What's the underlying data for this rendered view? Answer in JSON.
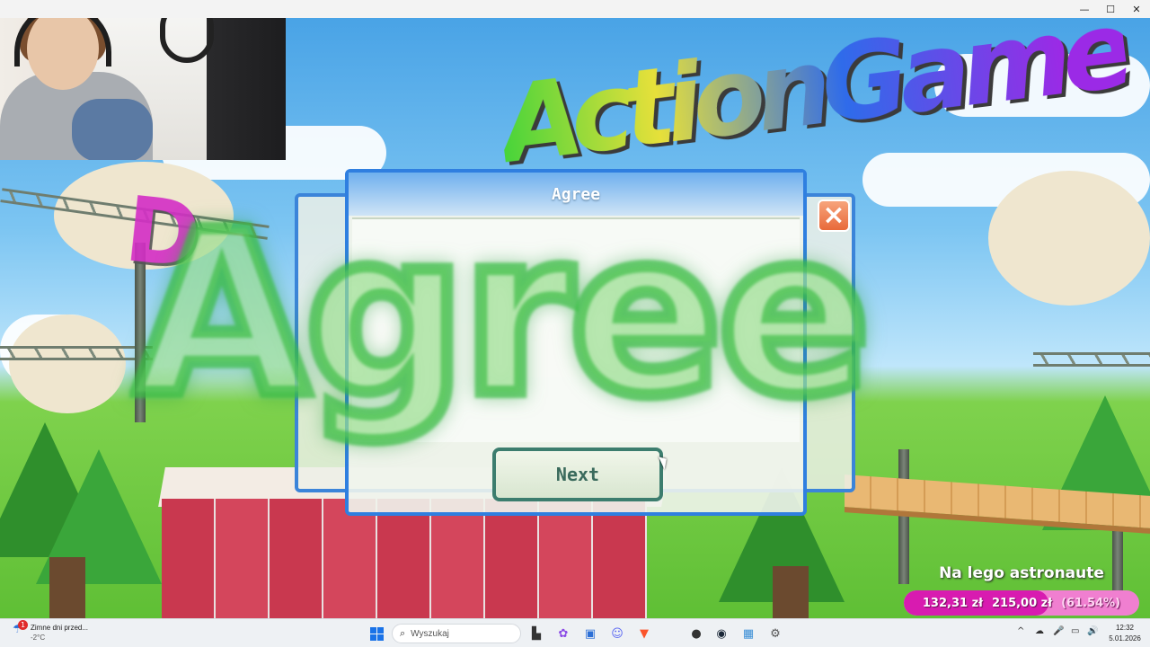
{
  "window": {
    "minimize_icon": "minimize-icon",
    "maximize_icon": "maximize-icon",
    "close_icon": "close-icon",
    "minimize_glyph": "—",
    "maximize_glyph": "☐",
    "close_glyph": "✕"
  },
  "game": {
    "title_partial": "ActionGame",
    "title_left_partial": "D"
  },
  "dialog": {
    "title": "Agree",
    "next_label": "Next",
    "close_glyph": "×",
    "overlay_text": "Agree"
  },
  "donation": {
    "label": "Na lego astronaute",
    "current": "132,31 zł",
    "goal": "215,00 zł",
    "percent": "(61.54%)",
    "fill_fraction": 0.6154,
    "bar_color": "#d81bb0"
  },
  "taskbar": {
    "weather": {
      "text": "Zimne dni przed...",
      "temp": "-2°C",
      "badge": "1"
    },
    "search_placeholder": "Wyszukaj",
    "apps": [
      {
        "name": "file-explorer-icon",
        "glyph": "▙"
      },
      {
        "name": "copilot-icon",
        "glyph": "✿"
      },
      {
        "name": "store-icon",
        "glyph": "▣"
      },
      {
        "name": "discord-icon",
        "glyph": "☺"
      },
      {
        "name": "brave-icon",
        "glyph": "▼"
      },
      {
        "name": "obs-icon",
        "glyph": "●"
      },
      {
        "name": "steam-icon",
        "glyph": "◉"
      },
      {
        "name": "game-app-icon",
        "glyph": "▦"
      },
      {
        "name": "settings-icon",
        "glyph": "⚙"
      }
    ],
    "tray": [
      "^",
      "☁",
      "🎤",
      "▭",
      "🔊"
    ],
    "time": "12:32",
    "date": "5.01.2026"
  }
}
